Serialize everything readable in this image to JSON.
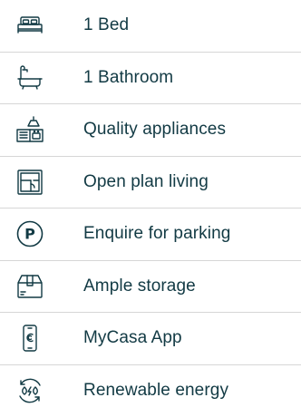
{
  "colors": {
    "icon": "#123a44",
    "text": "#123a44",
    "divider": "#d6d6d6",
    "background": "#ffffff"
  },
  "features": [
    {
      "label": "1 Bed",
      "icon": "bed-icon"
    },
    {
      "label": "1 Bathroom",
      "icon": "bathtub-icon"
    },
    {
      "label": "Quality appliances",
      "icon": "kitchen-appliances-icon"
    },
    {
      "label": "Open plan living",
      "icon": "floor-plan-icon"
    },
    {
      "label": "Enquire for parking",
      "icon": "parking-icon",
      "icon_text": "P"
    },
    {
      "label": "Ample storage",
      "icon": "storage-box-icon"
    },
    {
      "label": "MyCasa App",
      "icon": "smartphone-app-icon"
    },
    {
      "label": "Renewable energy",
      "icon": "renewable-energy-icon"
    }
  ]
}
